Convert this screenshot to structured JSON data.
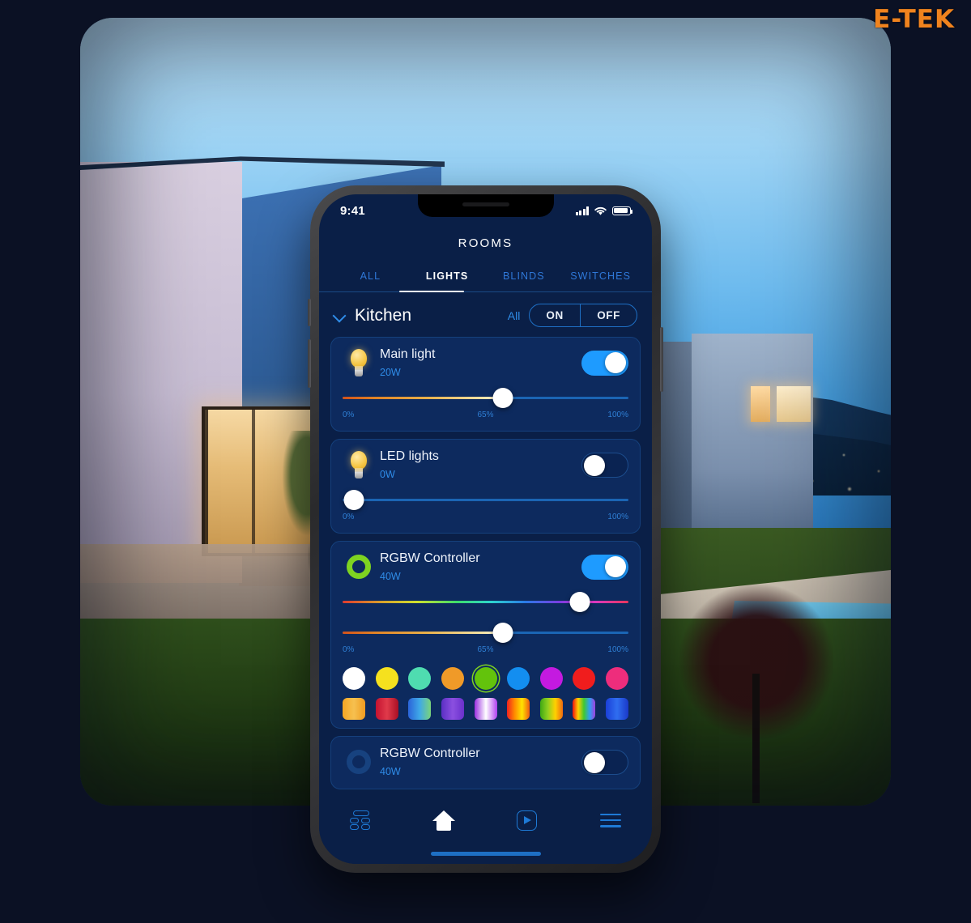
{
  "brand": {
    "logo": "E-TEK"
  },
  "backdrop": {
    "scene_description": "modern house at dusk with pool, mountains and city lights"
  },
  "status_bar": {
    "time": "9:41",
    "icons": [
      "signal-icon",
      "wifi-icon",
      "battery-icon"
    ]
  },
  "header": {
    "title": "ROOMS"
  },
  "tabs": [
    {
      "label": "ALL",
      "active": false
    },
    {
      "label": "LIGHTS",
      "active": true
    },
    {
      "label": "BLINDS",
      "active": false
    },
    {
      "label": "SWITCHES",
      "active": false
    }
  ],
  "room": {
    "name": "Kitchen",
    "all_label": "All",
    "on_label": "ON",
    "off_label": "OFF",
    "chevron_icon": "chevron-down-icon"
  },
  "devices": [
    {
      "name": "Main light",
      "power": "20W",
      "icon": "lightbulb-icon",
      "toggle_state": "on",
      "brightness": {
        "value": 65,
        "label": "65%",
        "min_label": "0%",
        "max_label": "100%"
      }
    },
    {
      "name": "LED lights",
      "power": "0W",
      "icon": "lightbulb-icon",
      "toggle_state": "off",
      "brightness": {
        "value": 0,
        "label": "0%",
        "min_label": "0%",
        "max_label": "100%"
      }
    },
    {
      "name": "RGBW Controller",
      "power": "40W",
      "icon": "color-ring-icon",
      "toggle_state": "on",
      "hue": {
        "value": 83
      },
      "brightness": {
        "value": 65,
        "label": "65%",
        "min_label": "0%",
        "max_label": "100%"
      }
    },
    {
      "name": "RGBW Controller",
      "power": "40W",
      "icon": "color-ring-icon",
      "toggle_state": "off"
    }
  ],
  "color_swatches": [
    {
      "name": "white",
      "color": "#ffffff",
      "selected": false
    },
    {
      "name": "yellow",
      "color": "#f5e11e",
      "selected": false
    },
    {
      "name": "mint",
      "color": "#4fdcb0",
      "selected": false
    },
    {
      "name": "orange",
      "color": "#f09a28",
      "selected": false
    },
    {
      "name": "green",
      "color": "#63c30c",
      "selected": true
    },
    {
      "name": "blue",
      "color": "#138ef0",
      "selected": false
    },
    {
      "name": "magenta",
      "color": "#c41ae0",
      "selected": false
    },
    {
      "name": "red",
      "color": "#f01d1d",
      "selected": false
    },
    {
      "name": "pink",
      "color": "#ee2d7c",
      "selected": false
    }
  ],
  "gradient_swatches": [
    {
      "name": "orange-gradient",
      "css": "linear-gradient(90deg,#f5a623,#f6c050,#ef9b20)"
    },
    {
      "name": "red-gradient",
      "css": "linear-gradient(90deg,#c41230,#e03a4a,#a80f24)"
    },
    {
      "name": "blue-green-gradient",
      "css": "linear-gradient(90deg,#2b63d8,#3fa8e8,#7ad47a)"
    },
    {
      "name": "purple-gradient",
      "css": "linear-gradient(90deg,#5b2fc4,#8b4fe0,#6a30cc)"
    },
    {
      "name": "purple-white-gradient",
      "css": "linear-gradient(90deg,#9b30e0,#ffffff,#b040f0)"
    },
    {
      "name": "red-yellow-gradient",
      "css": "linear-gradient(90deg,#f02020,#ff8a00,#ffe200,#f05a10)"
    },
    {
      "name": "green-orange-gradient",
      "css": "linear-gradient(90deg,#3fa814,#8fd020,#ffd000,#f06a10)"
    },
    {
      "name": "rainbow-gradient",
      "css": "linear-gradient(90deg,#f01010,#ffd000,#3fc830,#30a0f0,#a040e0)"
    },
    {
      "name": "blue-gradient",
      "css": "linear-gradient(90deg,#1b3fd8,#2f6ef0,#1a38c8)"
    }
  ],
  "bottom_nav": [
    {
      "name": "dashboard",
      "icon": "dashboard-icon",
      "active": false
    },
    {
      "name": "home",
      "icon": "home-icon",
      "active": true
    },
    {
      "name": "media",
      "icon": "play-icon",
      "active": false
    },
    {
      "name": "menu",
      "icon": "menu-icon",
      "active": false
    }
  ]
}
